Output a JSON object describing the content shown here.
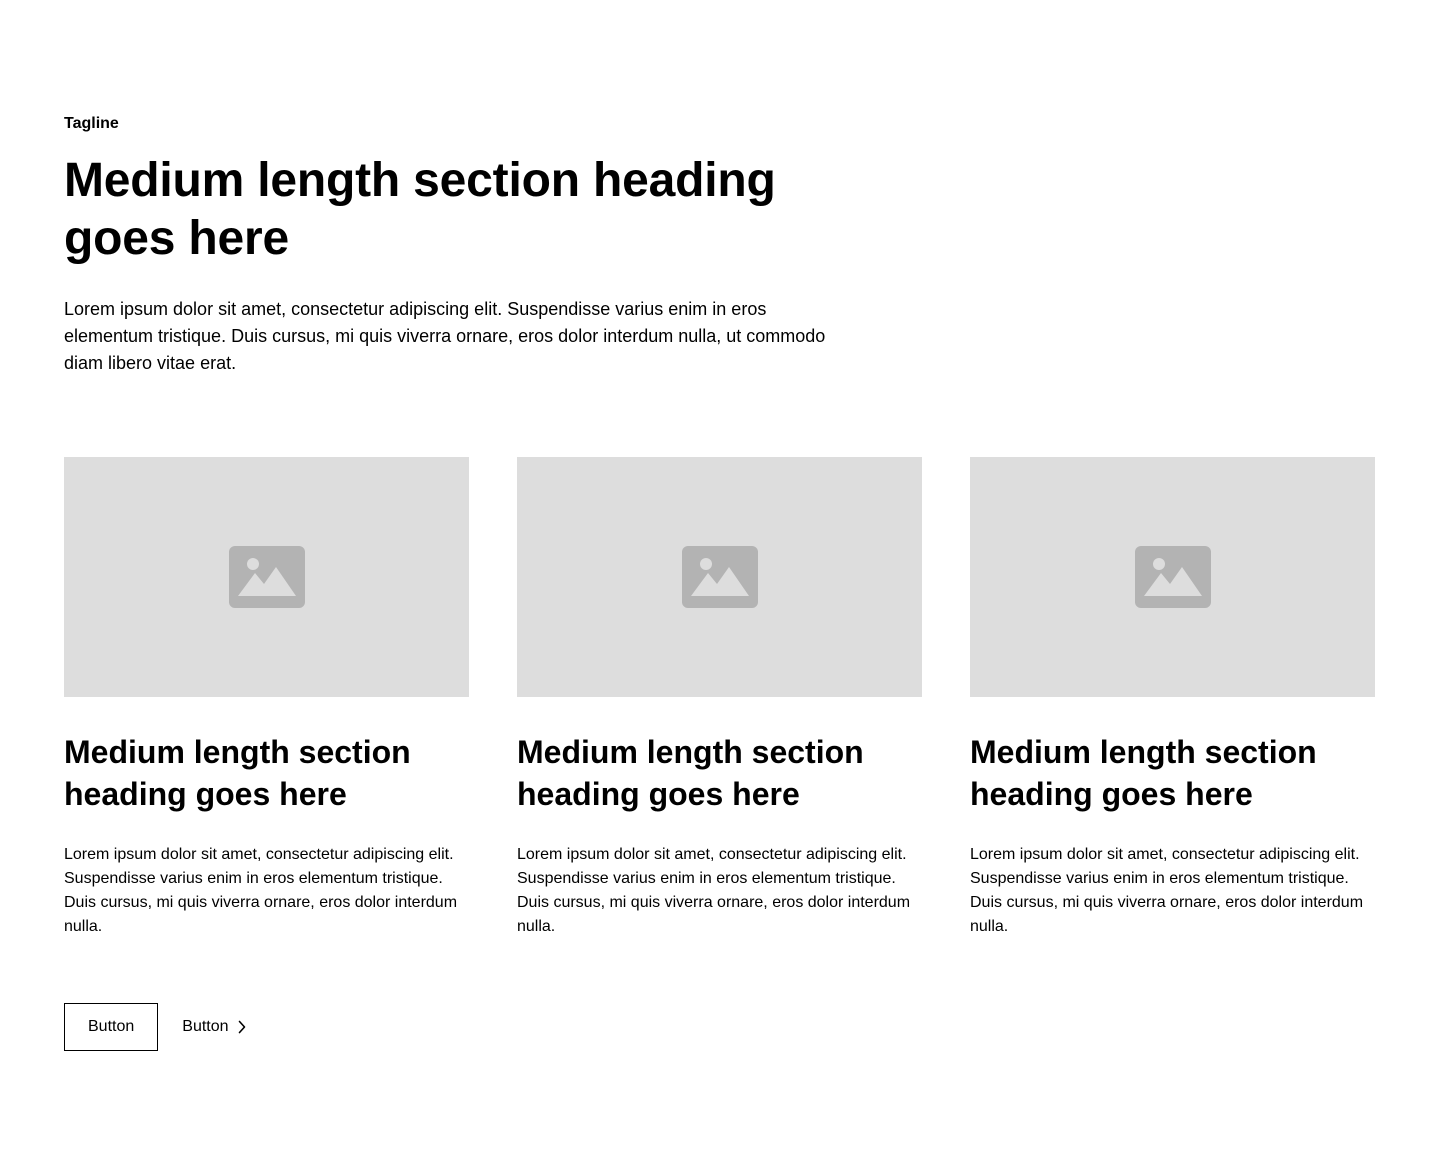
{
  "header": {
    "tagline": "Tagline",
    "heading": "Medium length section heading goes here",
    "description": "Lorem ipsum dolor sit amet, consectetur adipiscing elit. Suspendisse varius enim in eros elementum tristique. Duis cursus, mi quis viverra ornare, eros dolor interdum nulla, ut commodo diam libero vitae erat."
  },
  "cards": [
    {
      "image_icon": "image-placeholder-icon",
      "heading": "Medium length section heading goes here",
      "text": "Lorem ipsum dolor sit amet, consectetur adipiscing elit. Suspendisse varius enim in eros elementum tristique. Duis cursus, mi quis viverra ornare, eros dolor interdum nulla."
    },
    {
      "image_icon": "image-placeholder-icon",
      "heading": "Medium length section heading goes here",
      "text": "Lorem ipsum dolor sit amet, consectetur adipiscing elit. Suspendisse varius enim in eros elementum tristique. Duis cursus, mi quis viverra ornare, eros dolor interdum nulla."
    },
    {
      "image_icon": "image-placeholder-icon",
      "heading": "Medium length section heading goes here",
      "text": "Lorem ipsum dolor sit amet, consectetur adipiscing elit. Suspendisse varius enim in eros elementum tristique. Duis cursus, mi quis viverra ornare, eros dolor interdum nulla."
    }
  ],
  "actions": {
    "primary_label": "Button",
    "secondary_label": "Button",
    "secondary_icon": "chevron-right-icon"
  },
  "colors": {
    "text": "#000000",
    "background": "#ffffff",
    "placeholder_bg": "#dddddd",
    "placeholder_icon": "#b3b3b3"
  }
}
